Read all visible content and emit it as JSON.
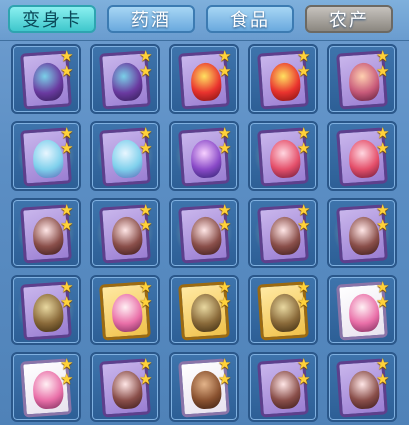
{
  "tabs": [
    {
      "label": "变身卡",
      "selected": true
    },
    {
      "label": "药酒",
      "selected": false
    },
    {
      "label": "食品",
      "selected": false
    },
    {
      "label": "农产",
      "selected": false
    }
  ],
  "star_glyph": "★",
  "items": [
    {
      "icon": "dragon-card-icon",
      "frame": "purple",
      "stars": 2,
      "glow": false,
      "art": "f-dragon"
    },
    {
      "icon": "dragon-card-icon",
      "frame": "purple",
      "stars": 2,
      "glow": false,
      "art": "f-dragon"
    },
    {
      "icon": "lion-dance-card-icon",
      "frame": "purple",
      "stars": 2,
      "glow": false,
      "art": "f-lion"
    },
    {
      "icon": "lion-dance-card-icon",
      "frame": "purple",
      "stars": 2,
      "glow": false,
      "art": "f-lion"
    },
    {
      "icon": "fox-spirit-card-icon",
      "frame": "purple",
      "stars": 2,
      "glow": false,
      "art": "f-fox"
    },
    {
      "icon": "white-cat-card-icon",
      "frame": "purple",
      "stars": 2,
      "glow": true,
      "art": "f-cat"
    },
    {
      "icon": "fairy-spirit-card-icon",
      "frame": "purple",
      "stars": 2,
      "glow": true,
      "art": "f-cat"
    },
    {
      "icon": "phoenix-bird-card-icon",
      "frame": "purple",
      "stars": 2,
      "glow": true,
      "art": "f-bird"
    },
    {
      "icon": "armored-warrior-card-icon",
      "frame": "purple",
      "stars": 2,
      "glow": true,
      "art": "f-warrior"
    },
    {
      "icon": "fire-girl-card-icon",
      "frame": "purple",
      "stars": 2,
      "glow": false,
      "art": "f-warrior"
    },
    {
      "icon": "bat-demon-card-icon",
      "frame": "purple",
      "stars": 2,
      "glow": true,
      "art": "f-bat"
    },
    {
      "icon": "bat-demon-card-icon",
      "frame": "purple",
      "stars": 2,
      "glow": true,
      "art": "f-bat"
    },
    {
      "icon": "bat-demon-card-icon",
      "frame": "purple",
      "stars": 2,
      "glow": true,
      "art": "f-bat"
    },
    {
      "icon": "bat-demon-card-icon",
      "frame": "purple",
      "stars": 2,
      "glow": true,
      "art": "f-bat"
    },
    {
      "icon": "bat-demon-card-icon",
      "frame": "purple",
      "stars": 2,
      "glow": true,
      "art": "f-bat"
    },
    {
      "icon": "golden-knight-card-icon",
      "frame": "purple",
      "stars": 2,
      "glow": true,
      "art": "f-knight"
    },
    {
      "icon": "red-hair-hero-card-icon",
      "frame": "gold",
      "stars": 2,
      "glow": false,
      "art": "f-girl"
    },
    {
      "icon": "sword-fairy-card-icon",
      "frame": "gold",
      "stars": 2,
      "glow": false,
      "art": "f-knight"
    },
    {
      "icon": "sword-fairy-card-icon",
      "frame": "gold",
      "stars": 2,
      "glow": false,
      "art": "f-knight"
    },
    {
      "icon": "pink-hair-girl-card-icon",
      "frame": "white",
      "stars": 2,
      "glow": false,
      "art": "f-girl"
    },
    {
      "icon": "pink-hair-girl-card-icon",
      "frame": "white",
      "stars": 2,
      "glow": false,
      "art": "f-girl"
    },
    {
      "icon": "bat-demon-card-icon",
      "frame": "purple",
      "stars": 2,
      "glow": false,
      "art": "f-bat"
    },
    {
      "icon": "brown-bear-card-icon",
      "frame": "white",
      "stars": 2,
      "glow": false,
      "art": "f-bear"
    },
    {
      "icon": "bat-demon-card-icon",
      "frame": "purple",
      "stars": 2,
      "glow": false,
      "art": "f-bat"
    },
    {
      "icon": "bat-demon-card-icon",
      "frame": "purple",
      "stars": 2,
      "glow": false,
      "art": "f-bat"
    }
  ]
}
